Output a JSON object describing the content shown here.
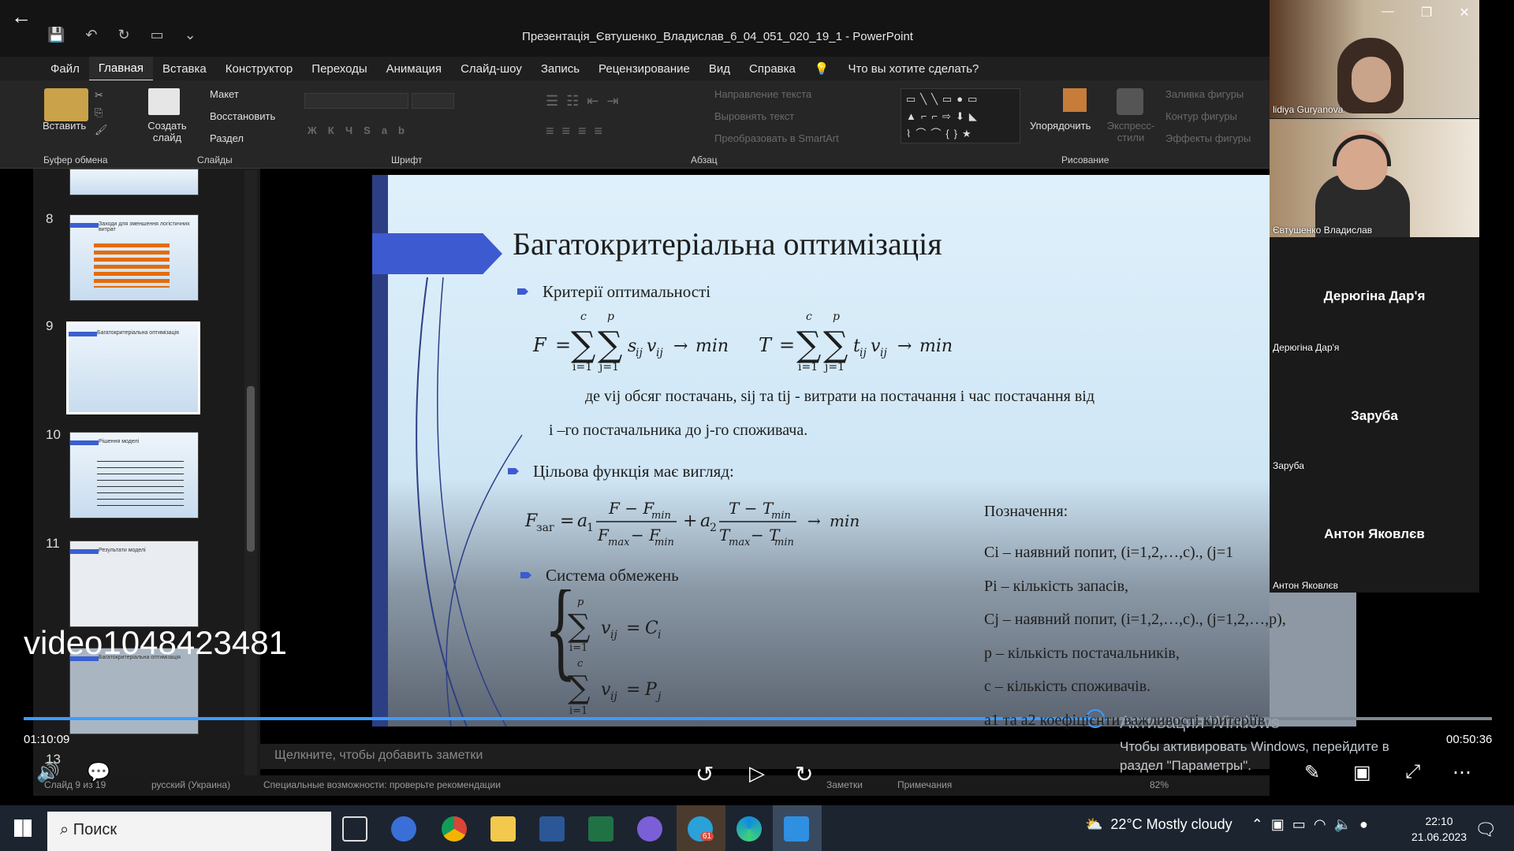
{
  "window": {
    "title": "Презентація_Євтушенко_Владислав_6_04_051_020_19_1  -  PowerPoint"
  },
  "ribbon_tabs": [
    "Файл",
    "Главная",
    "Вставка",
    "Конструктор",
    "Переходы",
    "Анимация",
    "Слайд-шоу",
    "Запись",
    "Рецензирование",
    "Вид",
    "Справка"
  ],
  "tell_me": "Что вы хотите сделать?",
  "ribbon": {
    "paste": "Вставить",
    "new_slide": "Создать слайд",
    "layout": "Макет",
    "reset": "Восстановить",
    "section": "Раздел",
    "text_direction": "Направление текста",
    "align_text": "Выровнять текст",
    "smartart": "Преобразовать в SmartArt",
    "arrange": "Упорядочить",
    "quick_styles": "Экспресс-стили",
    "shape_fill": "Заливка фигуры",
    "shape_outline": "Контур фигуры",
    "shape_effects": "Эффекты фигуры",
    "groups": {
      "clipboard": "Буфер обмена",
      "slides": "Слайды",
      "font": "Шрифт",
      "paragraph": "Абзац",
      "drawing": "Рисование"
    }
  },
  "thumbnails": [
    {
      "num": "8",
      "title": "Заходи для зменшення логістичних витрат"
    },
    {
      "num": "9",
      "title": "Багатокритеріальна оптимізація"
    },
    {
      "num": "10",
      "title": "Рішення моделі"
    },
    {
      "num": "11",
      "title": "Результати моделі"
    },
    {
      "num": "12",
      "title": "Багатокритеріальна оптимізація"
    },
    {
      "num": "13",
      "title": ""
    }
  ],
  "slide": {
    "title": "Багатокритеріальна оптимізація",
    "bullet1": "Критерії оптимальності",
    "where_line1": "де vij обсяг постачань, sij та tij  - витрати на постачання і час постачання від",
    "where_line2": "i –го постачальника до j-го споживача.",
    "bullet2": "Цільова функція має вигляд:",
    "bullet3": "Система обмежень",
    "legend_title": "Позначення:",
    "legend": [
      "Ci – наявний попит, (i=1,2,…,c)., (j=1",
      "Pi – кількість запасів,",
      "Cj – наявний попит, (i=1,2,…,c)., (j=1,2,…,p),",
      "p – кількість постачальників,",
      "c – кількість споживачів.",
      "a1  та a2 коефіцієнти важливості критеріїв"
    ]
  },
  "participants": [
    {
      "name": "lidiya Guryanova",
      "video": true
    },
    {
      "name": "Євтушенко Владислав",
      "video": true
    },
    {
      "name": "Дерюгіна Дар'я",
      "video": false
    },
    {
      "name": "Заруба",
      "video": false
    },
    {
      "name": "Антон Яковлєв",
      "video": false
    }
  ],
  "notes_placeholder": "Щелкните, чтобы добавить заметки",
  "status": {
    "slide": "Слайд 9 из 19",
    "language": "русский (Украина)",
    "accessibility": "Специальные возможности: проверьте рекомендации",
    "notes": "Заметки",
    "comments": "Примечания",
    "zoom": "82%"
  },
  "video": {
    "id": "video1048423481",
    "current": "01:10:09",
    "total": "00:50:36",
    "progress": 0.73
  },
  "windows_activation": {
    "title": "Активация Windows",
    "text": "Чтобы активировать Windows, перейдите в раздел \"Параметры\"."
  },
  "taskbar": {
    "search": "Поиск",
    "weather": "22°C  Mostly cloudy",
    "time": "22:10",
    "date": "21.06.2023",
    "telegram_badge": "61"
  }
}
